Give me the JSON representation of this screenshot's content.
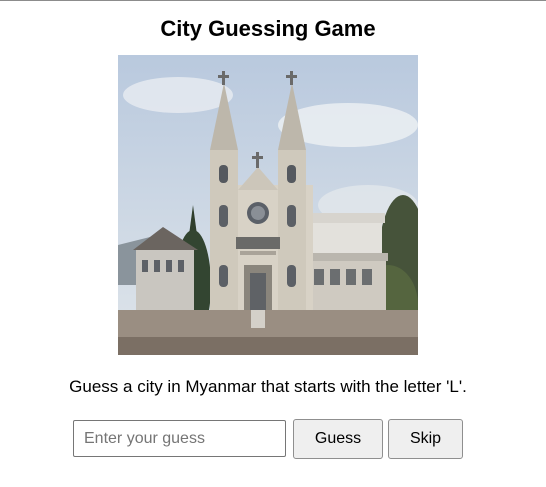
{
  "game": {
    "title": "City Guessing Game",
    "prompt": "Guess a city in Myanmar that starts with the letter 'L'.",
    "input_placeholder": "Enter your guess",
    "input_value": "",
    "guess_label": "Guess",
    "skip_label": "Skip"
  },
  "colors": {
    "sky": "#c9d6e6",
    "church_wall": "#d8d2c6",
    "ground": "#9a8e82"
  }
}
